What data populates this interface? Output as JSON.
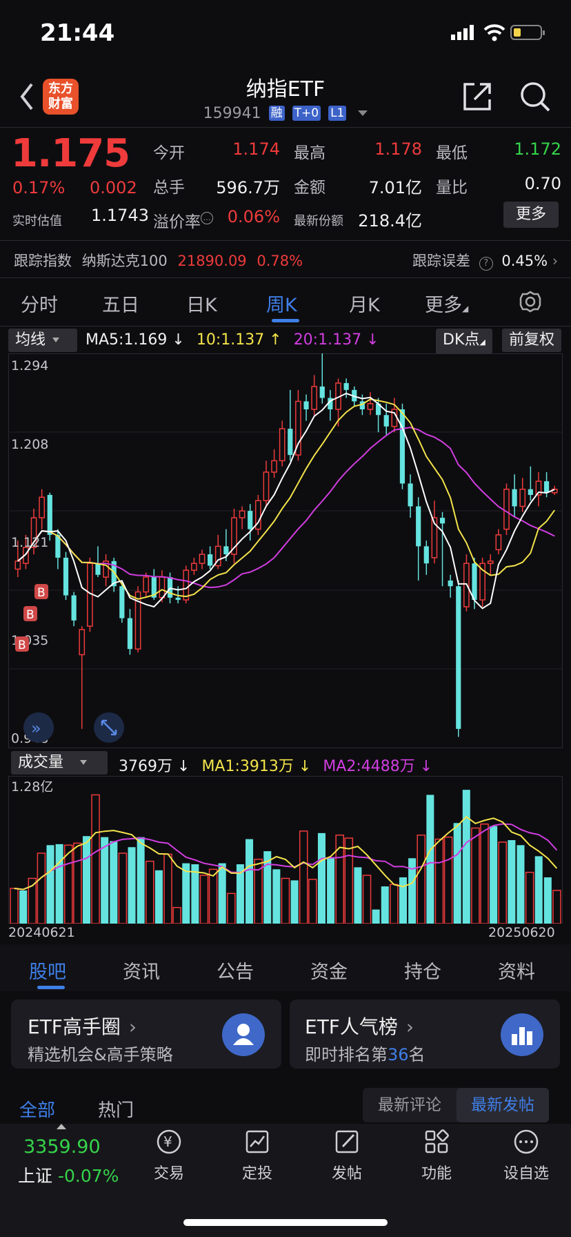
{
  "status": {
    "time": "21:44"
  },
  "header": {
    "logo_line1": "东方",
    "logo_line2": "财富",
    "title": "纳指ETF",
    "code": "159941",
    "tags": [
      "融",
      "T+0",
      "L1"
    ]
  },
  "quote": {
    "price": "1.175",
    "pct": "0.17%",
    "change": "0.002",
    "est_label": "实时估值",
    "est_value": "1.1743",
    "open_label": "今开",
    "open": "1.174",
    "high_label": "最高",
    "high": "1.178",
    "low_label": "最低",
    "low": "1.172",
    "vol_label": "总手",
    "vol": "596.7万",
    "amt_label": "金额",
    "amt": "7.01亿",
    "ratio_label": "量比",
    "ratio": "0.70",
    "premium_label": "溢价率",
    "premium": "0.06%",
    "shares_label": "最新份额",
    "shares": "218.4亿",
    "more": "更多"
  },
  "tracking": {
    "label": "跟踪指数",
    "index": "纳斯达克100",
    "value": "21890.09",
    "pct": "0.78%",
    "err_label": "跟踪误差",
    "err": "0.45%"
  },
  "tabs": [
    "分时",
    "五日",
    "日K",
    "周K",
    "月K",
    "更多"
  ],
  "ma": {
    "selector": "均线",
    "ma5": "MA5:1.169",
    "ma10": "10:1.137",
    "ma20": "20:1.137",
    "dk": "DK点",
    "adj": "前复权"
  },
  "price_axis": {
    "top": "1.294",
    "upper": "1.208",
    "mid": "1.121",
    "lower": "1.035",
    "bottom": "0.948"
  },
  "volume": {
    "selector": "成交量",
    "v": "3769万",
    "ma1": "MA1:3913万",
    "ma2": "MA2:4488万",
    "top": "1.28亿"
  },
  "dates": {
    "start": "20240621",
    "end": "20250620"
  },
  "subtabs": [
    "股吧",
    "资讯",
    "公告",
    "资金",
    "持仓",
    "资料"
  ],
  "cards": [
    {
      "title": "ETF高手圈",
      "sub": "精选机会&高手策略"
    },
    {
      "title": "ETF人气榜",
      "sub_pre": "即时排名第",
      "rank": "36",
      "sub_post": "名"
    }
  ],
  "feed": {
    "all": "全部",
    "hot": "热门",
    "latest_comment": "最新评论",
    "latest_post": "最新发帖"
  },
  "index_bar": {
    "value": "3359.90",
    "label": "上证",
    "pct": "-0.07%"
  },
  "nav": [
    "交易",
    "定投",
    "发帖",
    "功能",
    "设自选"
  ],
  "colors": {
    "up": "#ef3b3b",
    "down": "#65e3df",
    "ma5": "#ffffff",
    "ma10": "#f4e44a",
    "ma20": "#d23ee0",
    "accent": "#3f7fe8"
  },
  "chart_data": {
    "type": "candlestick",
    "x_range": [
      "20240621",
      "20250620"
    ],
    "ylim": [
      0.948,
      1.294
    ],
    "candles": [
      [
        1.105,
        1.112,
        1.13,
        1.098
      ],
      [
        1.11,
        1.124,
        1.135,
        1.105
      ],
      [
        1.124,
        1.15,
        1.158,
        1.118
      ],
      [
        1.15,
        1.168,
        1.175,
        1.14
      ],
      [
        1.17,
        1.135,
        1.172,
        1.13
      ],
      [
        1.135,
        1.115,
        1.14,
        1.105
      ],
      [
        1.115,
        1.082,
        1.12,
        1.078
      ],
      [
        1.082,
        1.06,
        1.085,
        1.055
      ],
      [
        1.03,
        1.052,
        1.055,
        0.965
      ],
      [
        1.055,
        1.11,
        1.115,
        1.05
      ],
      [
        1.11,
        1.1,
        1.125,
        1.098
      ],
      [
        1.098,
        1.112,
        1.118,
        1.09
      ],
      [
        1.112,
        1.09,
        1.115,
        1.085
      ],
      [
        1.09,
        1.062,
        1.095,
        1.058
      ],
      [
        1.062,
        1.035,
        1.07,
        1.03
      ],
      [
        1.035,
        1.085,
        1.09,
        1.032
      ],
      [
        1.085,
        1.098,
        1.102,
        1.08
      ],
      [
        1.098,
        1.08,
        1.105,
        1.078
      ],
      [
        1.08,
        1.098,
        1.104,
        1.076
      ],
      [
        1.098,
        1.08,
        1.102,
        1.075
      ],
      [
        1.08,
        1.078,
        1.09,
        1.075
      ],
      [
        1.078,
        1.104,
        1.108,
        1.075
      ],
      [
        1.104,
        1.11,
        1.115,
        1.1
      ],
      [
        1.11,
        1.118,
        1.122,
        1.105
      ],
      [
        1.118,
        1.108,
        1.125,
        1.105
      ],
      [
        1.108,
        1.125,
        1.135,
        1.105
      ],
      [
        1.125,
        1.118,
        1.14,
        1.112
      ],
      [
        1.118,
        1.15,
        1.158,
        1.11
      ],
      [
        1.15,
        1.156,
        1.16,
        1.14
      ],
      [
        1.156,
        1.14,
        1.162,
        1.13
      ],
      [
        1.14,
        1.165,
        1.17,
        1.135
      ],
      [
        1.165,
        1.19,
        1.2,
        1.16
      ],
      [
        1.19,
        1.2,
        1.21,
        1.185
      ],
      [
        1.2,
        1.228,
        1.235,
        1.195
      ],
      [
        1.228,
        1.205,
        1.262,
        1.2
      ],
      [
        1.205,
        1.252,
        1.262,
        1.2
      ],
      [
        1.252,
        1.245,
        1.258,
        1.235
      ],
      [
        1.245,
        1.265,
        1.275,
        1.24
      ],
      [
        1.265,
        1.255,
        1.295,
        1.25
      ],
      [
        1.255,
        1.245,
        1.262,
        1.235
      ],
      [
        1.245,
        1.268,
        1.272,
        1.23
      ],
      [
        1.268,
        1.262,
        1.272,
        1.255
      ],
      [
        1.262,
        1.252,
        1.265,
        1.248
      ],
      [
        1.252,
        1.245,
        1.258,
        1.24
      ],
      [
        1.245,
        1.25,
        1.26,
        1.24
      ],
      [
        1.25,
        1.24,
        1.255,
        1.225
      ],
      [
        1.24,
        1.23,
        1.25,
        1.222
      ],
      [
        1.23,
        1.245,
        1.255,
        1.225
      ],
      [
        1.245,
        1.18,
        1.25,
        1.175
      ],
      [
        1.18,
        1.16,
        1.188,
        1.15
      ],
      [
        1.16,
        1.125,
        1.168,
        1.095
      ],
      [
        1.125,
        1.11,
        1.13,
        1.1
      ],
      [
        1.115,
        1.15,
        1.165,
        1.11
      ],
      [
        1.15,
        1.145,
        1.155,
        1.09
      ],
      [
        1.095,
        1.09,
        1.1,
        1.08
      ],
      [
        1.09,
        0.965,
        1.095,
        0.958
      ],
      [
        1.072,
        1.11,
        1.118,
        1.068
      ],
      [
        1.11,
        1.078,
        1.115,
        1.07
      ],
      [
        1.078,
        1.11,
        1.115,
        1.072
      ],
      [
        1.11,
        1.112,
        1.118,
        1.1
      ],
      [
        1.122,
        1.135,
        1.14,
        1.118
      ],
      [
        1.14,
        1.175,
        1.18,
        1.135
      ],
      [
        1.175,
        1.16,
        1.188,
        1.15
      ],
      [
        1.16,
        1.175,
        1.185,
        1.155
      ],
      [
        1.175,
        1.17,
        1.195,
        1.165
      ],
      [
        1.17,
        1.182,
        1.19,
        1.16
      ],
      [
        1.182,
        1.172,
        1.19,
        1.168
      ],
      [
        1.172,
        1.175,
        1.178,
        1.17
      ]
    ],
    "volume_max": 1.28,
    "volumes": [
      0.35,
      0.33,
      0.45,
      0.7,
      0.78,
      0.79,
      0.78,
      0.8,
      0.87,
      1.28,
      0.86,
      0.82,
      0.7,
      0.76,
      0.86,
      0.62,
      0.53,
      0.69,
      0.16,
      0.6,
      0.59,
      0.48,
      0.54,
      0.6,
      0.3,
      0.59,
      0.84,
      0.64,
      0.72,
      0.54,
      0.45,
      0.43,
      0.92,
      0.44,
      0.9,
      0.65,
      0.88,
      0.85,
      0.56,
      0.48,
      0.14,
      0.37,
      0.39,
      0.46,
      0.65,
      0.88,
      1.28,
      0.84,
      0.86,
      1.0,
      1.33,
      0.95,
      0.99,
      0.97,
      0.81,
      0.83,
      0.78,
      0.51,
      0.67,
      0.46,
      0.33
    ]
  }
}
